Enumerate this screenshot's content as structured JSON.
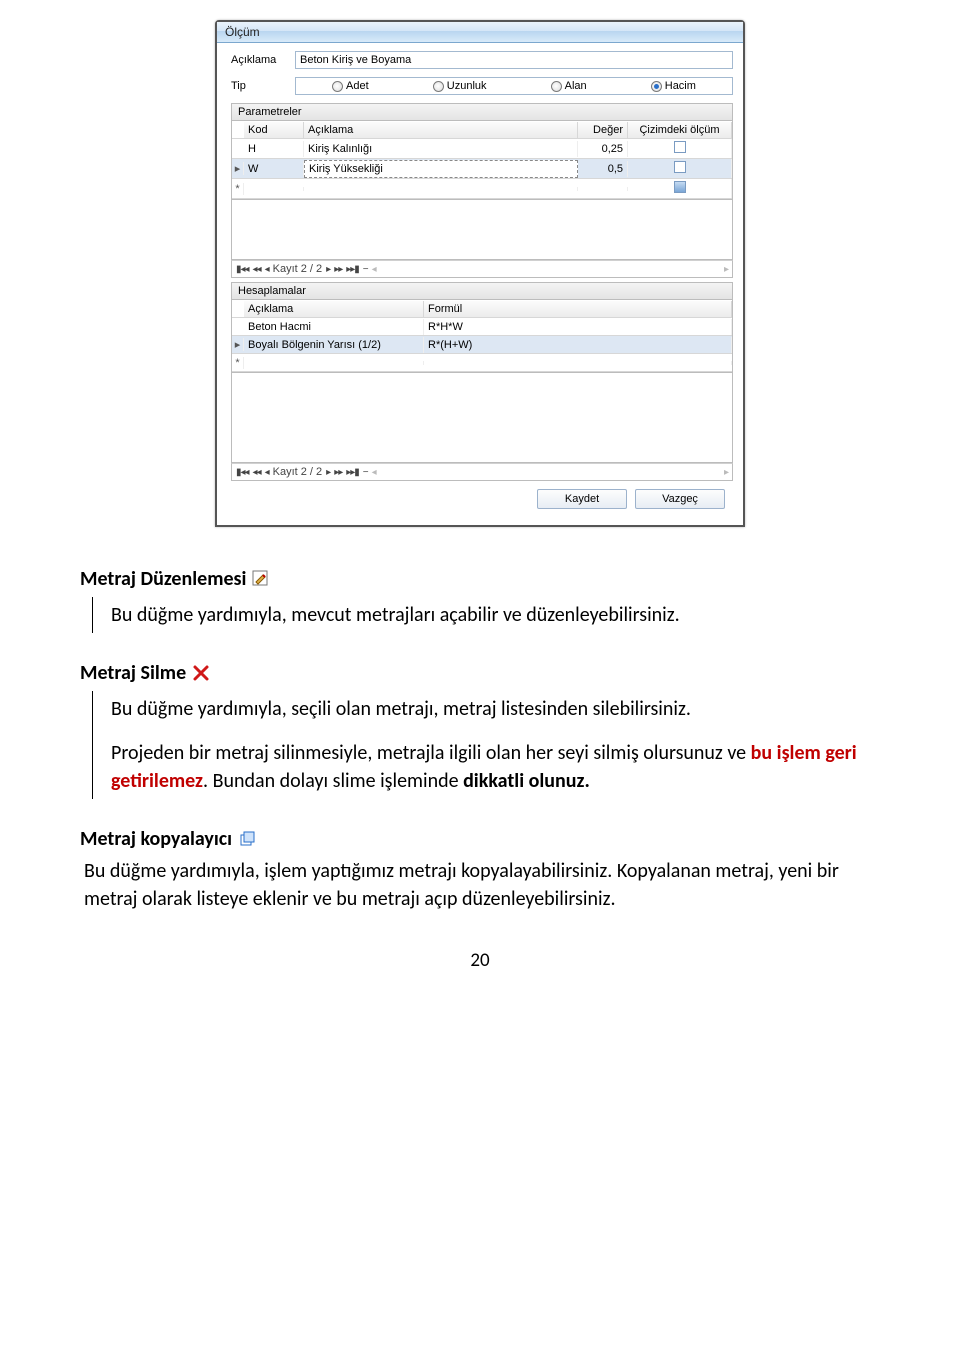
{
  "window": {
    "title": "Ölçüm",
    "aciklama_label": "Açıklama",
    "aciklama_value": "Beton Kiriş ve Boyama",
    "tip_label": "Tip",
    "radios": {
      "adet": "Adet",
      "uzunluk": "Uzunluk",
      "alan": "Alan",
      "hacim": "Hacim"
    },
    "parametreler": {
      "header": "Parametreler",
      "cols": {
        "kod": "Kod",
        "aciklama": "Açıklama",
        "deger": "Değer",
        "olcum": "Çizimdeki ölçüm"
      },
      "rows": [
        {
          "kod": "H",
          "aciklama": "Kiriş Kalınlığı",
          "deger": "0,25"
        },
        {
          "kod": "W",
          "aciklama": "Kiriş Yüksekliği",
          "deger": "0,5"
        }
      ],
      "nav": "Kayıt 2 / 2"
    },
    "hesaplamalar": {
      "header": "Hesaplamalar",
      "cols": {
        "aciklama": "Açıklama",
        "formul": "Formül"
      },
      "rows": [
        {
          "aciklama": "Beton Hacmi",
          "formul": "R*H*W"
        },
        {
          "aciklama": "Boyalı Bölgenin Yarısı (1/2)",
          "formul": "R*(H+W)"
        }
      ],
      "nav": "Kayıt 2 / 2"
    },
    "buttons": {
      "save": "Kaydet",
      "cancel": "Vazgeç"
    }
  },
  "sections": {
    "edit": {
      "title": "Metraj Düzenlemesi",
      "body": "Bu düğme yardımıyla, mevcut metrajları açabilir ve düzenleyebilirsiniz."
    },
    "delete": {
      "title": "Metraj Silme",
      "p1": "Bu düğme yardımıyla, seçili olan metrajı, metraj listesinden silebilirsiniz.",
      "p2a": "Projeden bir metraj silinmesiyle, metrajla ilgili olan her seyi silmiş olursunuz ve ",
      "p2_red": "bu işlem geri getirilemez",
      "p2b": ". Bundan dolayı slime işleminde ",
      "p2_bold": "dikkatli olunuz.",
      "p2c": ""
    },
    "copy": {
      "title": "Metraj kopyalayıcı",
      "body": "Bu düğme yardımıyla, işlem yaptığımız metrajı kopyalayabilirsiniz. Kopyalanan metraj, yeni bir metraj olarak listeye eklenir ve bu metrajı açıp düzenleyebilirsiniz."
    }
  },
  "page_number": "20"
}
